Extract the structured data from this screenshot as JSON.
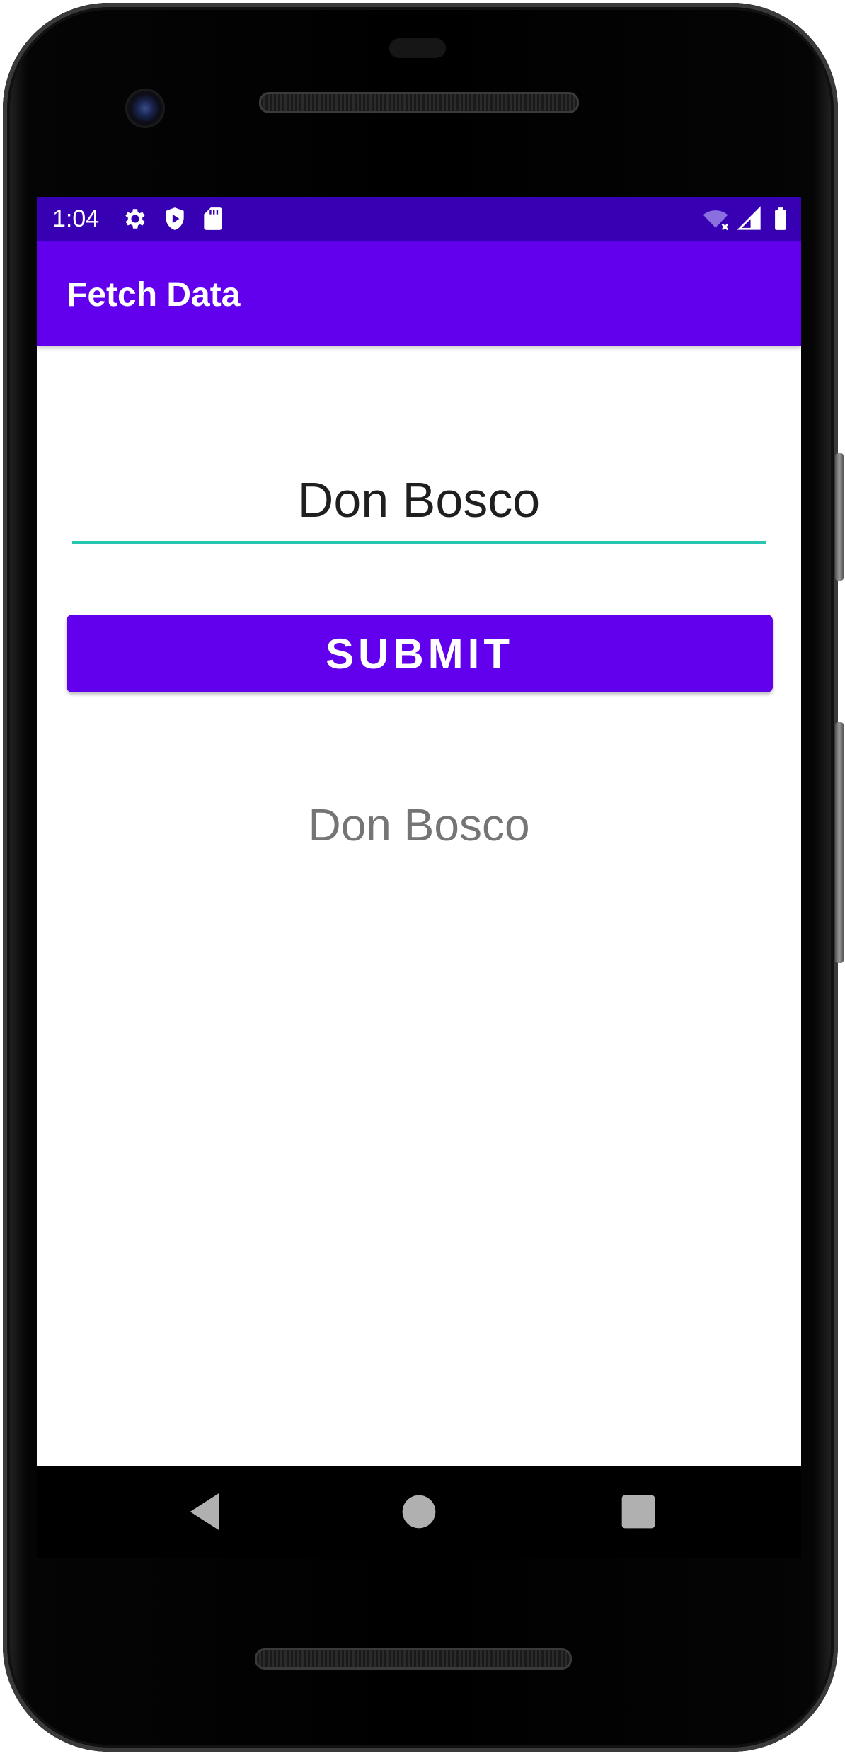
{
  "status_bar": {
    "time": "1:04",
    "icons": [
      "settings-icon",
      "shield-play-icon",
      "sd-card-icon",
      "wifi-off-icon",
      "signal-icon",
      "battery-icon"
    ]
  },
  "app_bar": {
    "title": "Fetch Data"
  },
  "form": {
    "input_value": "Don Bosco",
    "submit_label": "SUBMIT"
  },
  "result": {
    "text": "Don Bosco"
  },
  "nav_bar": {
    "icons": [
      "back-icon",
      "home-icon",
      "recents-icon"
    ]
  },
  "colors": {
    "status_bar": "#3700b3",
    "app_bar": "#6200ee",
    "button": "#6200ee",
    "input_underline": "#26c6b0",
    "result_text": "#757575"
  }
}
